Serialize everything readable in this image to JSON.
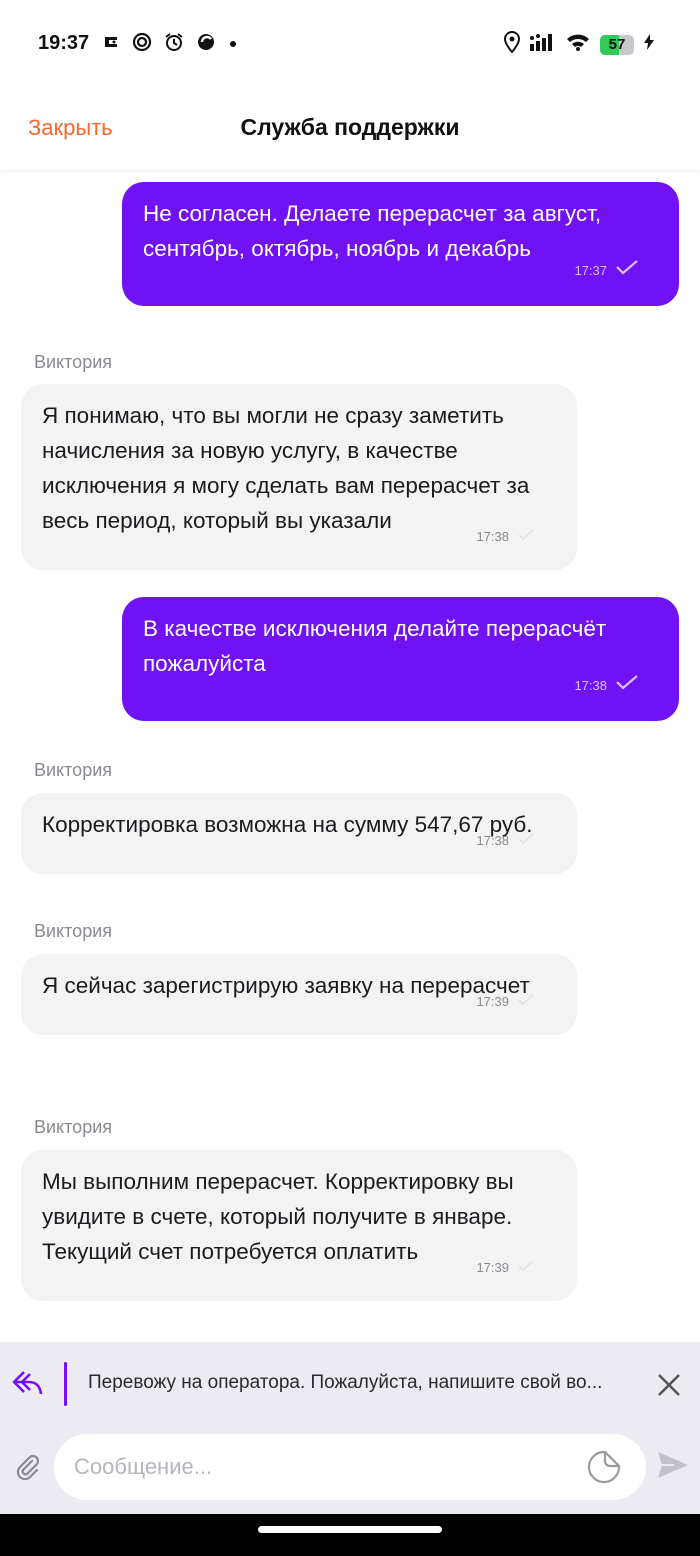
{
  "status_bar": {
    "time": "19:37",
    "battery": "57",
    "battery_level": 0.57,
    "left_icons": [
      "app-notification-icon",
      "target-app-icon",
      "alarm-icon",
      "moon-app-icon",
      "dot-icon"
    ],
    "right_icons": [
      "location-icon",
      "signal-icon",
      "wifi-icon",
      "battery-icon",
      "charging-icon"
    ]
  },
  "header": {
    "close_label": "Закрыть",
    "title": "Служба поддержки",
    "accent_color": "#f2682f"
  },
  "colors": {
    "outgoing_bubble": "#7012f4",
    "incoming_bubble": "#f3f3f4"
  },
  "messages": [
    {
      "direction": "out",
      "text": "Не согласен. Делаете перерасчет за август, сентябрь, октябрь, ноябрь и декабрь",
      "time": "17:37"
    },
    {
      "direction": "in",
      "sender": "Виктория",
      "text": "Я понимаю, что вы могли не сразу заметить начисления за новую услугу, в качестве исключения я могу сделать вам перерасчет за весь период, который вы указали",
      "time": "17:38"
    },
    {
      "direction": "out",
      "text": "В качестве исключения делайте перерасчёт пожалуйста",
      "time": "17:38"
    },
    {
      "direction": "in",
      "sender": "Виктория",
      "text": "Корректировка возможна на сумму 547,67 руб.",
      "time": "17:38"
    },
    {
      "direction": "in",
      "sender": "Виктория",
      "text": "Я сейчас зарегистрирую заявку на перерасчет",
      "time": "17:39"
    },
    {
      "direction": "in",
      "sender": "Виктория",
      "text": "Мы выполним перерасчет. Корректировку вы увидите в счете, который получите в январе. Текущий счет потребуется оплатить",
      "time": "17:39"
    }
  ],
  "reply": {
    "text": "Перевожу на оператора. Пожалуйста, напишите свой во..."
  },
  "composer": {
    "placeholder": "Сообщение...",
    "value": ""
  }
}
